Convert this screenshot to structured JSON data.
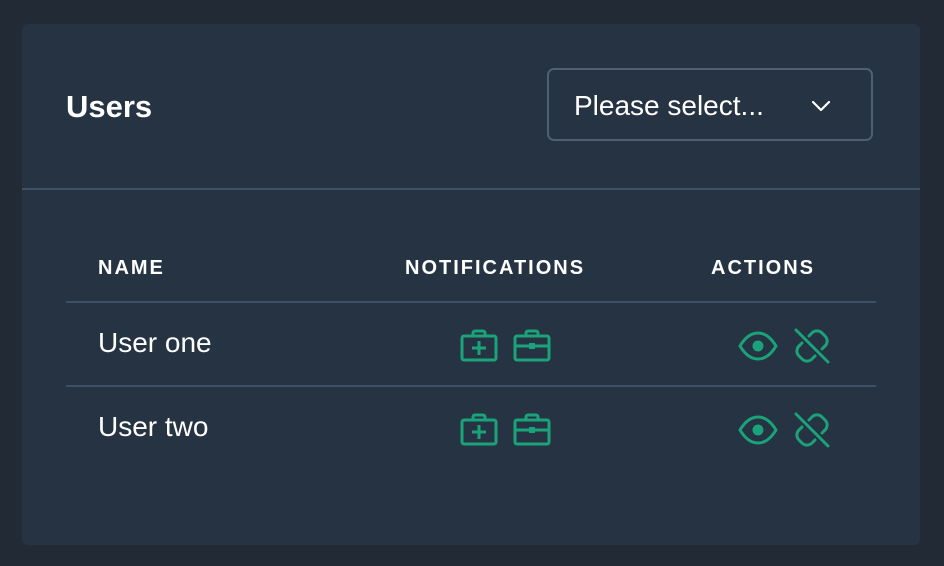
{
  "card": {
    "title": "Users",
    "select": {
      "placeholder": "Please select...",
      "icon": "chevron-down-icon"
    }
  },
  "table": {
    "columns": {
      "name": "NAME",
      "notifications": "NOTIFICATIONS",
      "actions": "ACTIONS"
    },
    "rows": [
      {
        "name": "User one",
        "notification_icons": [
          "medical-kit-icon",
          "briefcase-icon"
        ],
        "action_icons": [
          "eye-icon",
          "unlink-icon"
        ]
      },
      {
        "name": "User two",
        "notification_icons": [
          "medical-kit-icon",
          "briefcase-icon"
        ],
        "action_icons": [
          "eye-icon",
          "unlink-icon"
        ]
      }
    ]
  },
  "colors": {
    "background": "#222a35",
    "card": "#263342",
    "divider": "#3f5063",
    "accent": "#1aa37a",
    "text": "#ffffff"
  }
}
